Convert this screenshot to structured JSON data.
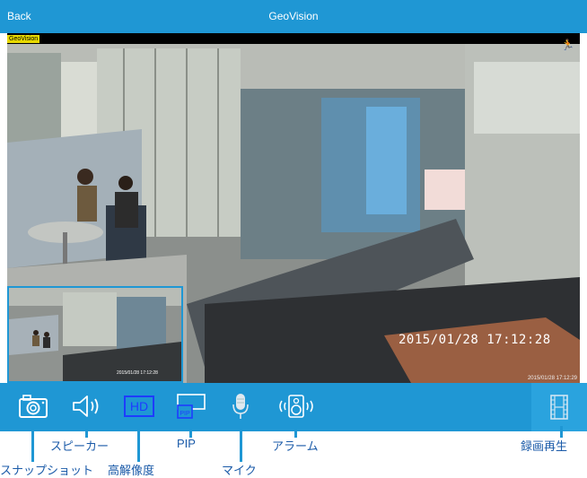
{
  "header": {
    "back_label": "Back",
    "title": "GeoVision"
  },
  "viewer": {
    "channel_label": "GeoVision",
    "timestamp": "2015/01/28  17:12:28",
    "timestamp_small": "2015/01/28 17:12:29",
    "pip_timestamp": "2015/01/28 17:12:28",
    "motion_icon": "running-person-icon"
  },
  "toolbar": {
    "buttons": [
      {
        "icon": "camera-icon"
      },
      {
        "icon": "speaker-icon"
      },
      {
        "icon": "hd-icon",
        "text": "HD"
      },
      {
        "icon": "pip-icon",
        "text": "PIP"
      },
      {
        "icon": "microphone-icon"
      },
      {
        "icon": "alarm-speaker-icon"
      },
      {
        "icon": "film-icon"
      }
    ]
  },
  "callouts": {
    "snapshot": "スナップショット",
    "speaker": "スピーカー",
    "high_resolution": "高解像度",
    "pip": "PIP",
    "mic": "マイク",
    "alarm": "アラーム",
    "playback": "録画再生"
  },
  "colors": {
    "accent": "#1f97d4",
    "callout_text": "#1a5aa8",
    "hd_blue": "#1e3cff"
  }
}
